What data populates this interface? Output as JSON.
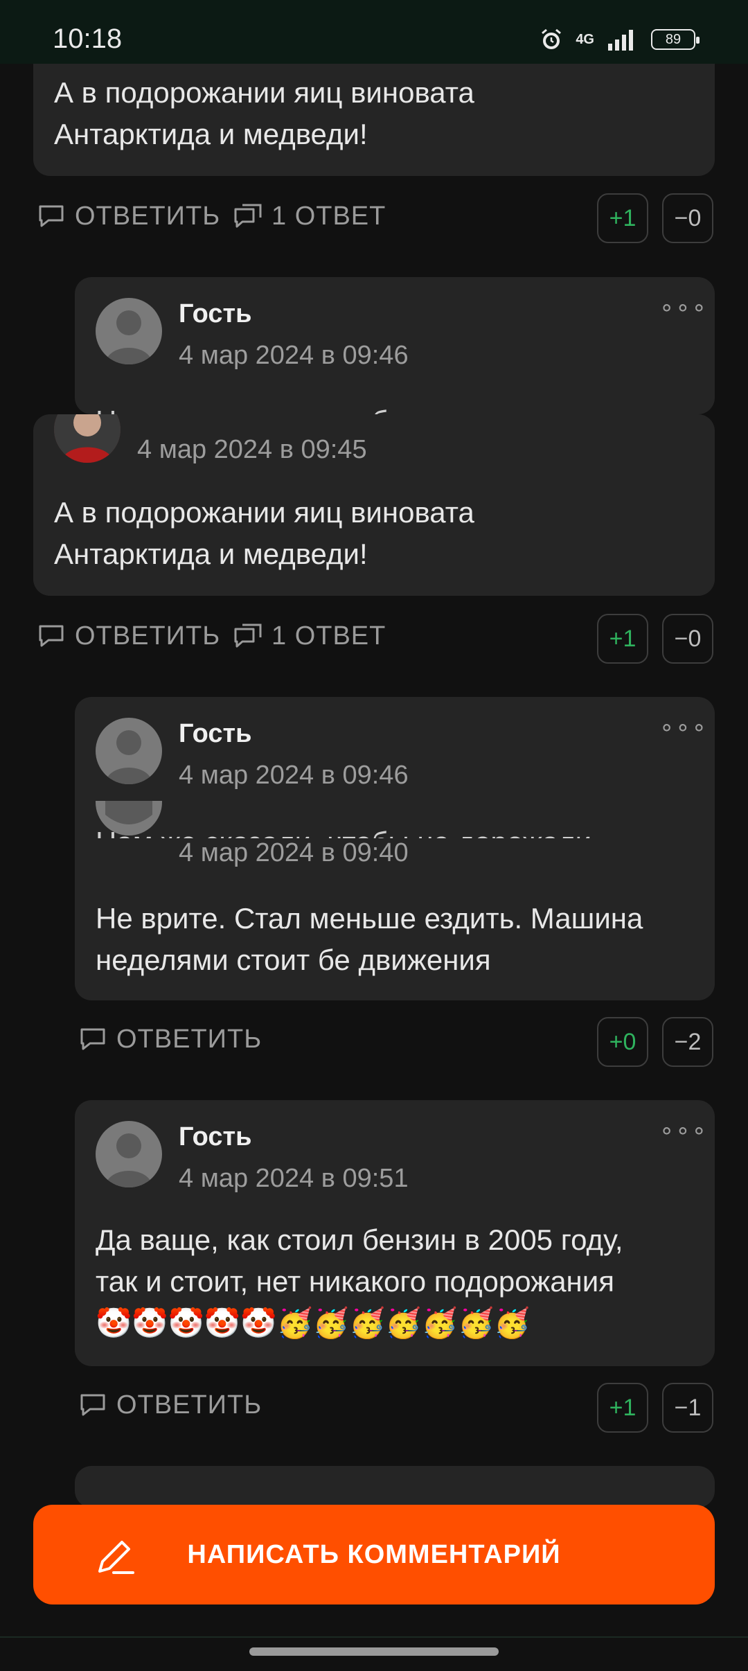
{
  "status": {
    "time": "10:18",
    "network": "4G",
    "battery": "89"
  },
  "comments": [
    {
      "text_line1": "А в подорожании яиц виновата",
      "text_line2": "Антарктида и медведи!",
      "reply_label": "ОТВЕТИТЬ",
      "replies_label": "1 ОТВЕТ",
      "plus": "+1",
      "minus": "−0"
    },
    {
      "author": "Гость",
      "date": "4 мар 2024 в 09:46",
      "cut_text": "Нам же сказали, чтобы не дорожали"
    },
    {
      "date": "4 мар 2024 в 09:45",
      "text_line1": "А в подорожании яиц виновата",
      "text_line2": "Антарктида и медведи!",
      "reply_label": "ОТВЕТИТЬ",
      "replies_label": "1 ОТВЕТ",
      "plus": "+1",
      "minus": "−0"
    },
    {
      "author": "Гость",
      "date": "4 мар 2024 в 09:46",
      "cut_text": "Нам же сказали, чтобы не дорожали"
    },
    {
      "date": "4 мар 2024 в 09:40",
      "text_line1": "Не врите. Стал меньше ездить. Машина",
      "text_line2": "неделями стоит бе движения",
      "reply_label": "ОТВЕТИТЬ",
      "plus": "+0",
      "minus": "−2"
    },
    {
      "author": "Гость",
      "date": "4 мар 2024 в 09:51",
      "text_line1": "Да ваще, как стоил бензин в 2005 году,",
      "text_line2": "так и стоит, нет никакого подорожания",
      "text_line3": "🤡🤡🤡🤡🤡🥳🥳🥳🥳🥳🥳🥳",
      "reply_label": "ОТВЕТИТЬ",
      "plus": "+1",
      "minus": "−1"
    }
  ],
  "fab": {
    "label": "НАПИСАТЬ КОММЕНТАРИЙ"
  },
  "icons": {
    "reply": "speech-bubble-icon",
    "replies": "double-bubble-icon",
    "menu": "more-dots-icon",
    "write": "pen-icon"
  },
  "colors": {
    "accent": "#ff4f00",
    "plus": "#2fb35e",
    "card": "#252525",
    "background": "#111111"
  }
}
